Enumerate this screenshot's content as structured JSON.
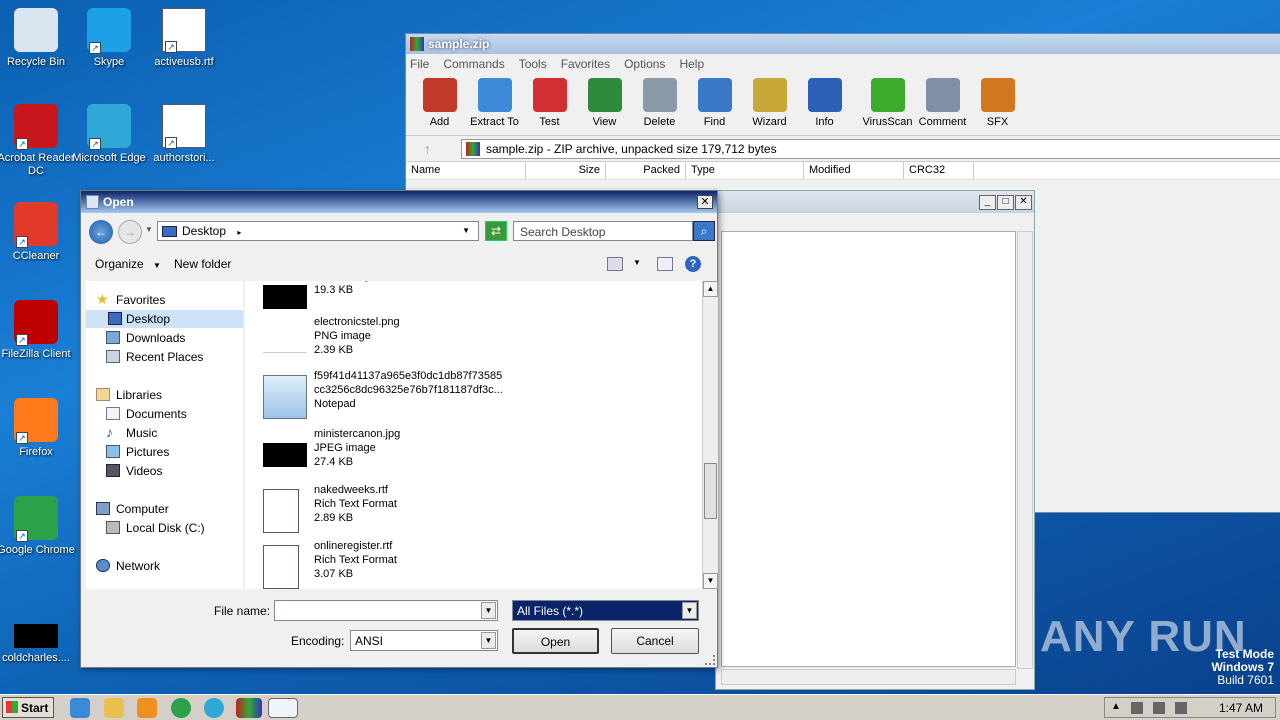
{
  "desktop": {
    "icons": [
      {
        "label": "Recycle Bin",
        "icon": "recycle-bin-icon",
        "color": "#d8e4f0"
      },
      {
        "label": "Skype",
        "icon": "skype-icon",
        "color": "#1ea0e6"
      },
      {
        "label": "activeusb.rtf",
        "icon": "word-document-icon",
        "color": "#ffffff"
      },
      {
        "label": "Acrobat Reader DC",
        "icon": "acrobat-icon",
        "color": "#c8161d"
      },
      {
        "label": "Microsoft Edge",
        "icon": "edge-icon",
        "color": "#2fa8d8"
      },
      {
        "label": "authorstori...",
        "icon": "word-document-icon",
        "color": "#ffffff"
      },
      {
        "label": "CCleaner",
        "icon": "ccleaner-icon",
        "color": "#e23a2a"
      },
      {
        "label": "FileZilla Client",
        "icon": "filezilla-icon",
        "color": "#bf0000"
      },
      {
        "label": "Firefox",
        "icon": "firefox-icon",
        "color": "#ff7a1a"
      },
      {
        "label": "Google Chrome",
        "icon": "chrome-icon",
        "color": "#2ba14b"
      },
      {
        "label": "coldcharles....",
        "icon": "black-thumbnail-icon",
        "color": "#000000"
      }
    ],
    "watermark": "ANY RUN",
    "testmode": {
      "line1": "Test Mode",
      "line2": "Windows 7",
      "line3": "Build 7601"
    }
  },
  "winrar": {
    "title": "sample.zip",
    "menu": [
      "File",
      "Commands",
      "Tools",
      "Favorites",
      "Options",
      "Help"
    ],
    "toolbar": [
      {
        "label": "Add",
        "color": "#c0392b"
      },
      {
        "label": "Extract To",
        "color": "#3c8ad8"
      },
      {
        "label": "Test",
        "color": "#d03030"
      },
      {
        "label": "View",
        "color": "#2e8b3e"
      },
      {
        "label": "Delete",
        "color": "#8a9aa8"
      },
      {
        "label": "Find",
        "color": "#3a78c8"
      },
      {
        "label": "Wizard",
        "color": "#c8a838"
      },
      {
        "label": "Info",
        "color": "#2c5fb8"
      },
      {
        "label": "VirusScan",
        "color": "#3caa2c"
      },
      {
        "label": "Comment",
        "color": "#7f8fa8"
      },
      {
        "label": "SFX",
        "color": "#d07820"
      }
    ],
    "address": "sample.zip - ZIP archive, unpacked size 179,712 bytes",
    "columns": [
      "Name",
      "Size",
      "Packed",
      "Type",
      "Modified",
      "CRC32"
    ]
  },
  "dialog": {
    "title": "Open",
    "location": "Desktop",
    "search_placeholder": "Search Desktop",
    "organize": "Organize",
    "new_folder": "New folder",
    "nav": {
      "favorites": "Favorites",
      "desktop": "Desktop",
      "downloads": "Downloads",
      "recent": "Recent Places",
      "libraries": "Libraries",
      "documents": "Documents",
      "music": "Music",
      "pictures": "Pictures",
      "videos": "Videos",
      "computer": "Computer",
      "local_disk": "Local Disk (C:)",
      "network": "Network"
    },
    "files": [
      {
        "name": "",
        "type": "JPEG image",
        "size": "19.3 KB",
        "thumb": "black"
      },
      {
        "name": "electronicstel.png",
        "type": "PNG image",
        "size": "2.39 KB",
        "thumb": "blank"
      },
      {
        "name": "f59f41d41137a965e3f0dc1db87f73585",
        "name2": "cc3256c8dc96325e76b7f181187df3c...",
        "type": "Notepad",
        "thumb": "notepad"
      },
      {
        "name": "ministercanon.jpg",
        "type": "JPEG image",
        "size": "27.4 KB",
        "thumb": "black"
      },
      {
        "name": "nakedweeks.rtf",
        "type": "Rich Text Format",
        "size": "2.89 KB",
        "thumb": "word"
      },
      {
        "name": "onlineregister.rtf",
        "type": "Rich Text Format",
        "size": "3.07 KB",
        "thumb": "word"
      }
    ],
    "file_name_label": "File name:",
    "file_name_value": "",
    "filter_value": "All Files  (*.*)",
    "encoding_label": "Encoding:",
    "encoding_value": "ANSI",
    "open_label": "Open",
    "cancel_label": "Cancel"
  },
  "taskbar": {
    "start_label": "Start",
    "clock": "1:47 AM"
  }
}
